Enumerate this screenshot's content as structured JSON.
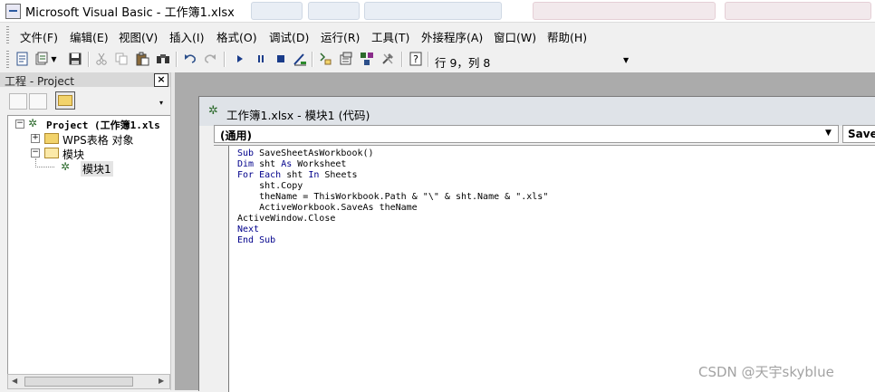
{
  "window": {
    "title": "Microsoft Visual Basic - 工作簿1.xlsx"
  },
  "menu": [
    {
      "label": "文件(F)"
    },
    {
      "label": "编辑(E)"
    },
    {
      "label": "视图(V)"
    },
    {
      "label": "插入(I)"
    },
    {
      "label": "格式(O)"
    },
    {
      "label": "调试(D)"
    },
    {
      "label": "运行(R)"
    },
    {
      "label": "工具(T)"
    },
    {
      "label": "外接程序(A)"
    },
    {
      "label": "窗口(W)"
    },
    {
      "label": "帮助(H)"
    }
  ],
  "toolbar": {
    "position": "行 9，列 8",
    "icons": [
      "view-excel-icon",
      "insert-module-icon",
      "save-icon",
      "cut-icon",
      "copy-icon",
      "paste-icon",
      "find-icon",
      "undo-icon",
      "redo-icon",
      "run-icon",
      "break-icon",
      "reset-icon",
      "design-mode-icon",
      "project-explorer-icon",
      "properties-icon",
      "object-browser-icon",
      "toolbox-icon",
      "help-icon"
    ]
  },
  "project": {
    "title": "工程 - Project",
    "close": "×",
    "tree": {
      "root": "Project (工作簿1.xls",
      "sheet_object": "WPS表格 对象",
      "modules_folder": "模块",
      "module": "模块1"
    }
  },
  "code_window": {
    "title": "工作簿1.xlsx - 模块1 (代码)",
    "object_combo": "(通用)",
    "procedure_combo": "SaveS",
    "lines": [
      "Sub SaveSheetAsWorkbook()",
      "Dim sht As Worksheet",
      "For Each sht In Sheets",
      "    sht.Copy",
      "    theName = ThisWorkbook.Path & \"\\\" & sht.Name & \".xls\"",
      "    ActiveWorkbook.SaveAs theName",
      "ActiveWindow.Close",
      "Next",
      "End Sub"
    ]
  },
  "watermark": "CSDN @天宇skyblue",
  "colors": {
    "mdi_background": "#ababab",
    "keyword": "#00008b",
    "title_bar": "#ffffff"
  }
}
